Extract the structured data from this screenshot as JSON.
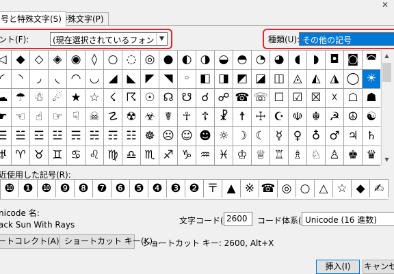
{
  "tabs": [
    {
      "label": "号と特殊文字(S)",
      "active": true
    },
    {
      "label": "特殊文字(P)",
      "active": false
    }
  ],
  "font": {
    "label": "ント(F):",
    "value": "(現在選択されているフォント)"
  },
  "subset": {
    "label": "種類(U):",
    "value": "その他の記号"
  },
  "symbol_grid": [
    [
      "◁",
      "◆",
      "◇",
      "◈",
      "◉",
      "◊",
      "○",
      "◌",
      "◎",
      "●",
      "◐",
      "◑",
      "◒",
      "◓",
      "◔",
      "◕",
      "◖",
      "◗",
      "◘",
      "◙",
      "◚"
    ],
    [
      "◜",
      "◝",
      "◞",
      "◟",
      "◠",
      "◡",
      "◢",
      "◣",
      "◤",
      "◥",
      "◦",
      "◧",
      "◨",
      "◩",
      "◪",
      "◫",
      "◬",
      "◭",
      "◮",
      "◯",
      "☀"
    ],
    [
      "☁",
      "☂",
      "☃",
      "☄",
      "★",
      "☆",
      "☇",
      "☈",
      "☉",
      "☊",
      "☋",
      "☌",
      "☍",
      "☎",
      "☏",
      "☐",
      "☑",
      "☒",
      "☓",
      "☖",
      "☗"
    ],
    [
      "☛",
      "☜",
      "☝",
      "☞",
      "☟",
      "☠",
      "☡",
      "☢",
      "☣",
      "☤",
      "☥",
      "☦",
      "☧",
      "☨",
      "☩",
      "☪",
      "☫",
      "☬",
      "☭",
      "☮",
      "☯"
    ],
    [
      "☰",
      "☱",
      "☲",
      "☳",
      "☴",
      "☵",
      "☶",
      "☷",
      "☸",
      "☹",
      "☺",
      "☻",
      "☼",
      "☽",
      "☾",
      "☿",
      "♀",
      "♁",
      "♂",
      "♃",
      "♄"
    ],
    [
      "♅",
      "♈",
      "♉",
      "♊",
      "♋",
      "♌",
      "♍",
      "♎",
      "♏",
      "♐",
      "♑",
      "♒",
      "♓",
      "♔",
      "♕",
      "♖",
      "♗",
      "♘",
      "♙",
      "♚",
      "♛"
    ]
  ],
  "selected_cell": {
    "row": 1,
    "col": 20
  },
  "recent": {
    "label": "近使用した記号(R):",
    "symbols": [
      "❿",
      "❶",
      "❿",
      "❾",
      "❽",
      "❼",
      "❻",
      "❺",
      "❹",
      "❸",
      "❷",
      "〒",
      "▲",
      "※",
      "☎",
      "◎",
      "○",
      "△",
      "☆",
      "◆",
      "✍"
    ]
  },
  "unicode": {
    "label": "nicode 名:",
    "name": "ack Sun With Rays"
  },
  "char_code": {
    "label": "文字コード(C):",
    "value": "2600"
  },
  "from": {
    "label": "コード体系(M):",
    "value": "Unicode (16 進数)"
  },
  "buttons": {
    "autocorrect": "ートコレクト(A)...",
    "shortcut_key": "ショートカット キー(K)...",
    "insert": "挿入(I)",
    "cancel": "キャンセル"
  },
  "shortcut_text": "ショートカット キー: 2600, Alt+X"
}
